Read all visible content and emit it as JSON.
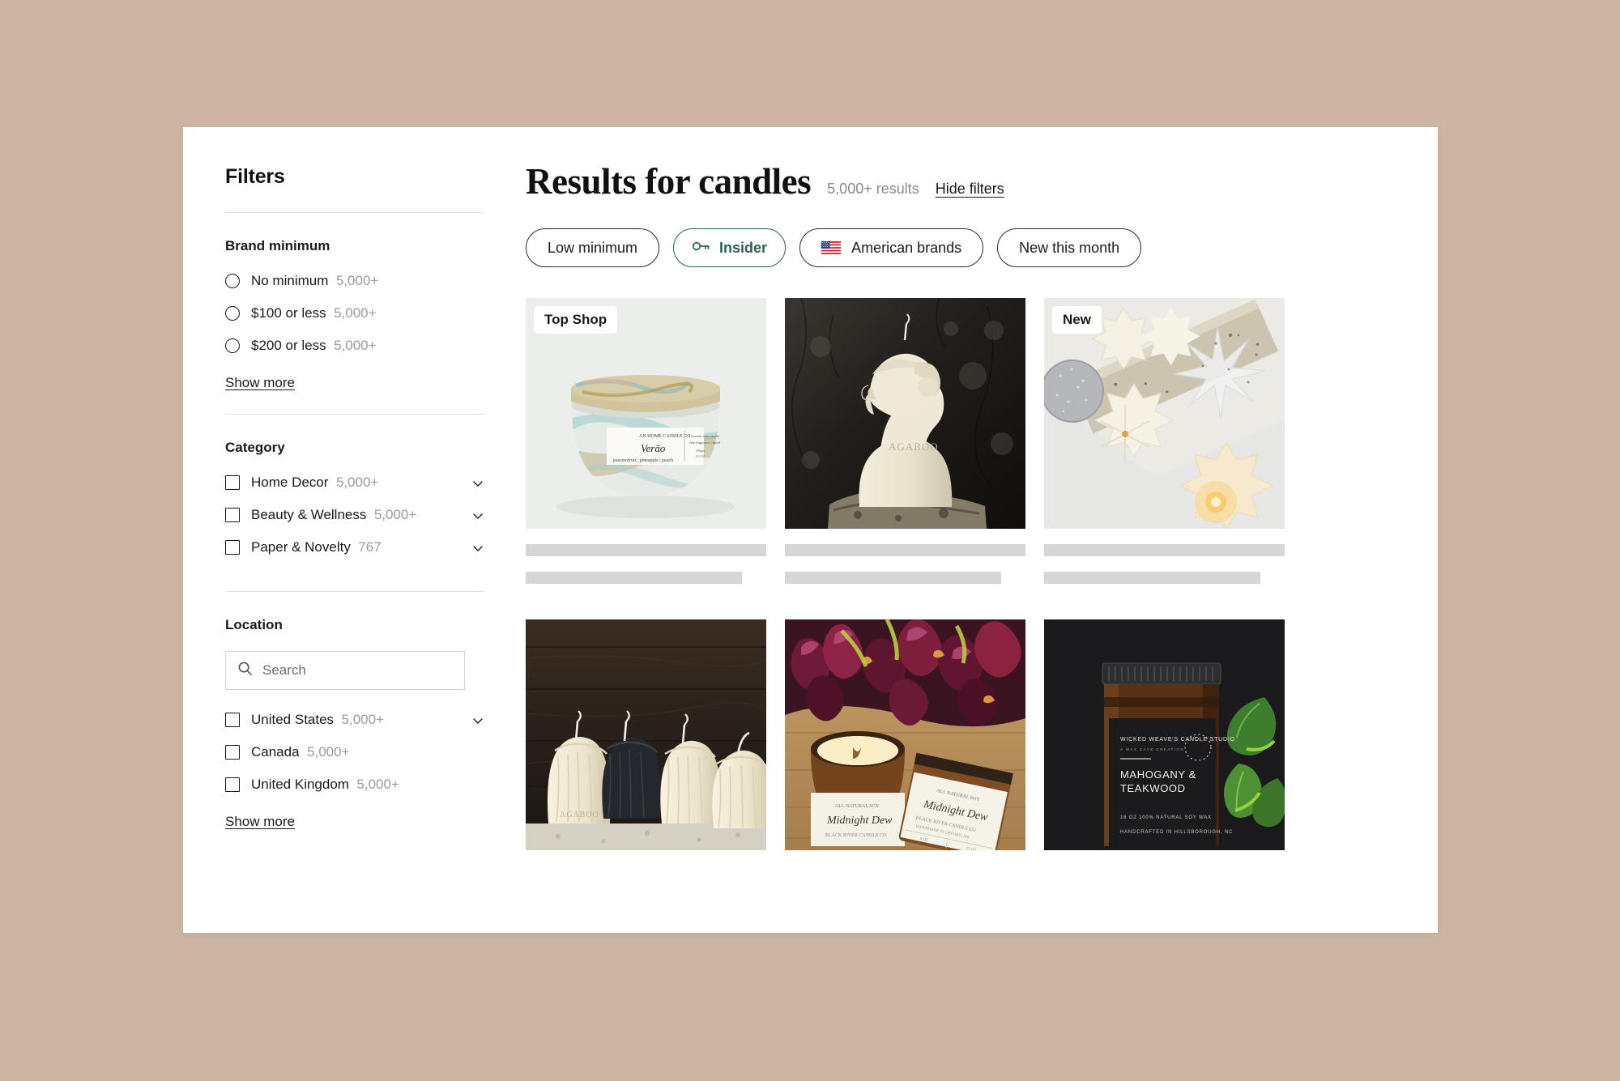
{
  "theme": {
    "background": "#ccb6a2",
    "panel": "#ffffff",
    "accent_teal": "#2c6057",
    "skeleton": "#d6d6d6"
  },
  "sidebar": {
    "title": "Filters",
    "groups": [
      {
        "name": "brand-minimum",
        "title": "Brand minimum",
        "control": "radio",
        "options": [
          {
            "label": "No minimum",
            "count": "5,000+"
          },
          {
            "label": "$100 or less",
            "count": "5,000+"
          },
          {
            "label": "$200 or less",
            "count": "5,000+"
          }
        ],
        "show_more": "Show more"
      },
      {
        "name": "category",
        "title": "Category",
        "control": "checkbox",
        "options": [
          {
            "label": "Home Decor",
            "count": "5,000+",
            "expandable": true
          },
          {
            "label": "Beauty & Wellness",
            "count": "5,000+",
            "expandable": true
          },
          {
            "label": "Paper & Novelty",
            "count": "767",
            "expandable": true
          }
        ]
      },
      {
        "name": "location",
        "title": "Location",
        "control": "checkbox",
        "search": {
          "placeholder": "Search",
          "value": ""
        },
        "options": [
          {
            "label": "United States",
            "count": "5,000+",
            "expandable": true
          },
          {
            "label": "Canada",
            "count": "5,000+"
          },
          {
            "label": "United Kingdom",
            "count": "5,000+"
          }
        ],
        "show_more": "Show more"
      }
    ]
  },
  "main": {
    "title": "Results for candles",
    "results_count": "5,000+ results",
    "hide_filters": "Hide filters",
    "chips": [
      {
        "label": "Low minimum",
        "icon": null,
        "active": false
      },
      {
        "label": "Insider",
        "icon": "key-icon",
        "active": true
      },
      {
        "label": "American brands",
        "icon": "us-flag-icon",
        "active": false
      },
      {
        "label": "New this month",
        "icon": null,
        "active": false
      }
    ],
    "cards": [
      {
        "name": "marbled-jar-candle",
        "badge": "Top Shop"
      },
      {
        "name": "bust-sculpture-candle",
        "badge": null
      },
      {
        "name": "snowflake-wax-melts",
        "badge": "New"
      },
      {
        "name": "veiled-figure-candles",
        "badge": null
      },
      {
        "name": "midnight-dew-jar-candles",
        "badge": null
      },
      {
        "name": "mahogany-teakwood-candle",
        "badge": null
      }
    ]
  }
}
